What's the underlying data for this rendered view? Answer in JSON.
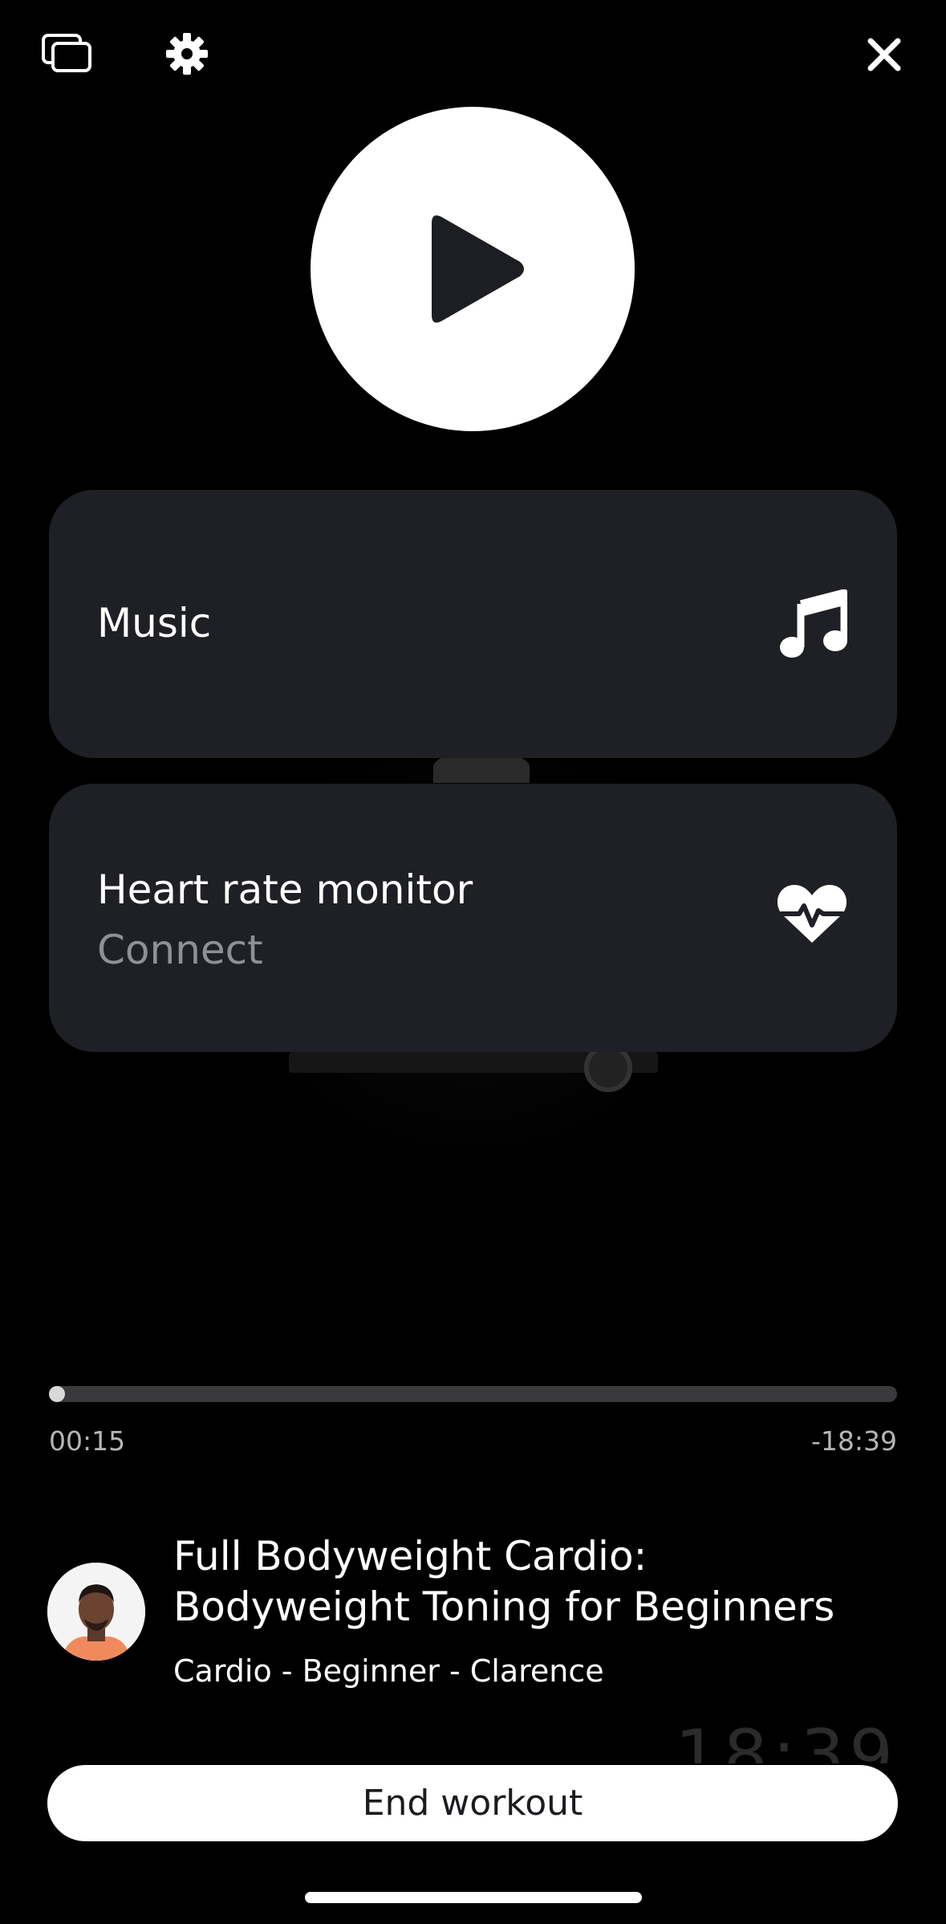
{
  "topbar": {
    "cast_icon": "cast-screen-icon",
    "settings_icon": "gear-icon",
    "close_icon": "close-icon"
  },
  "player": {
    "play_icon": "play-icon"
  },
  "cards": {
    "music": {
      "title": "Music",
      "icon": "music-note-icon"
    },
    "heart_rate": {
      "title": "Heart rate monitor",
      "subtitle": "Connect",
      "icon": "heart-pulse-icon"
    }
  },
  "progress": {
    "elapsed": "00:15",
    "remaining": "-18:39",
    "fraction": 0.013
  },
  "workout": {
    "title": "Full Bodyweight Cardio: Bodyweight Toning for Beginners",
    "meta": "Cardio - Beginner - Clarence",
    "timer": "18:39"
  },
  "actions": {
    "end_label": "End workout"
  },
  "colors": {
    "background": "#000000",
    "card": "#1f2025",
    "muted_text": "#8e9097",
    "button_bg": "#ffffff",
    "button_text": "#1b1c20"
  }
}
